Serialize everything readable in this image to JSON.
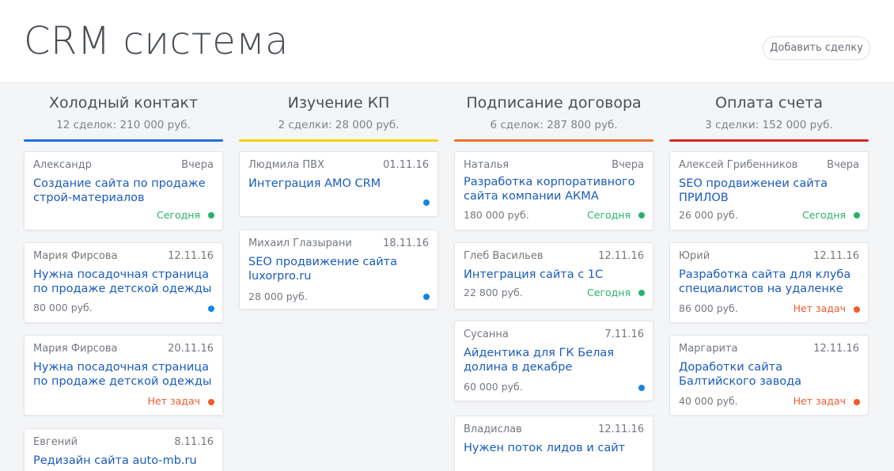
{
  "header": {
    "title": "CRM система",
    "add_deal_label": "Добавить сделку"
  },
  "colors": {
    "cold": "#1f6fd6",
    "study": "#f2d30f",
    "signing": "#ef6f2e",
    "payment": "#d9272b",
    "link": "#1a5bbf",
    "status_ok": "#27b36a",
    "status_none": "#ef5a2a",
    "status_info": "#1784e3"
  },
  "columns": [
    {
      "title": "Холодный контакт",
      "summary": "12 сделок: 210 000 руб.",
      "cards": [
        {
          "contact": "Александр",
          "date": "Вчера",
          "title": "Создание сайта по продаже строй-материалов",
          "price": "",
          "status": "Сегодня",
          "dot": "green"
        },
        {
          "contact": "Мария Фирсова",
          "date": "12.11.16",
          "title": "Нужна посадочная страница по продаже детской одежды",
          "price": "80 000 руб.",
          "status": "",
          "dot": "blue"
        },
        {
          "contact": "Мария Фирсова",
          "date": "20.11.16",
          "title": "Нужна посадочная страница по продаже детской одежды",
          "price": "",
          "status": "Нет задач",
          "dot": "red"
        },
        {
          "contact": "Евгений",
          "date": "8.11.16",
          "title": "Редизайн сайта auto-mb.ru",
          "price": "",
          "status": "",
          "dot": ""
        }
      ]
    },
    {
      "title": "Изучение КП",
      "summary": "2 сделки: 28 000 руб.",
      "cards": [
        {
          "contact": "Людмила ПВХ",
          "date": "01.11.16",
          "title": "Интеграция AMO CRM",
          "price": "",
          "status": "",
          "dot": "blue"
        },
        {
          "contact": "Михаил Глазырани",
          "date": "18.11.16",
          "title": "SEO продвижение сайта luxorpro.ru",
          "price": "28 000 руб.",
          "status": "",
          "dot": "blue"
        }
      ]
    },
    {
      "title": "Подписание договора",
      "summary": "6 сделок: 287 800 руб.",
      "cards": [
        {
          "contact": "Наталья",
          "date": "Вчера",
          "title": "Разработка корпоративного сайта компании АКМА",
          "price": "180 000 руб.",
          "status": "Сегодня",
          "dot": "green"
        },
        {
          "contact": "Глеб Васильев",
          "date": "12.11.16",
          "title": "Интеграция сайта с 1С",
          "price": "22 800 руб.",
          "status": "Сегодня",
          "dot": "green"
        },
        {
          "contact": "Сусанна",
          "date": "7.11.16",
          "title": "Айдентика для ГК Белая долина в декабре",
          "price": "60 000 руб.",
          "status": "",
          "dot": "blue"
        },
        {
          "contact": "Владислав",
          "date": "12.11.16",
          "title": "Нужен поток лидов и сайт",
          "price": "",
          "status": "",
          "dot": ""
        }
      ]
    },
    {
      "title": "Оплата счета",
      "summary": "3 сделки: 152 000 руб.",
      "cards": [
        {
          "contact": "Алексей Грибенников",
          "date": "Вчера",
          "title": "SEO продвиженеи сайта ПРИЛОВ",
          "price": "26 000 руб.",
          "status": "Сегодня",
          "dot": "green"
        },
        {
          "contact": "Юрий",
          "date": "12.11.16",
          "title": "Разработка сайта для клуба специалистов на удаленке",
          "price": "86 000 руб.",
          "status": "Нет задач",
          "dot": "red"
        },
        {
          "contact": "Маргарита",
          "date": "12.11.16",
          "title": "Доработки сайта Балтийского завода",
          "price": "40 000 руб.",
          "status": "Нет задач",
          "dot": "red"
        }
      ]
    }
  ]
}
